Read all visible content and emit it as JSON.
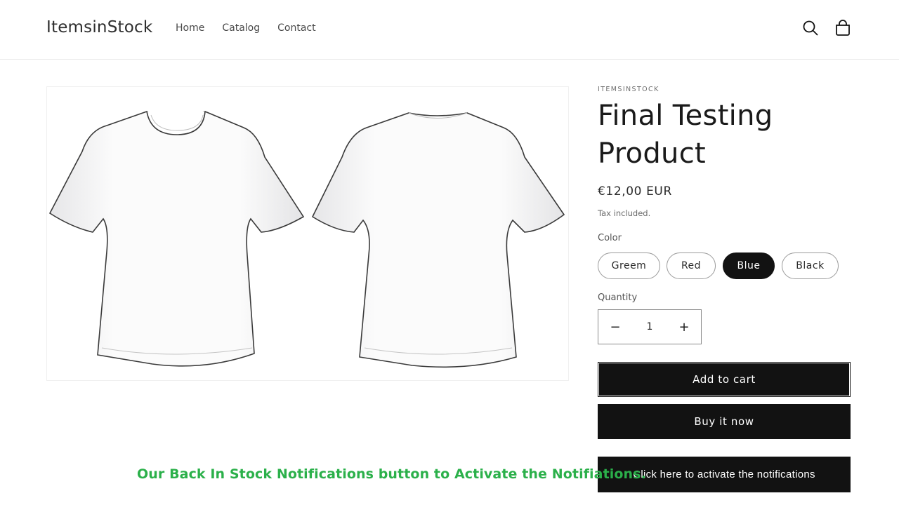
{
  "header": {
    "logo": "ItemsinStock",
    "nav": [
      "Home",
      "Catalog",
      "Contact"
    ],
    "icons": [
      "search-icon",
      "cart-icon"
    ]
  },
  "product": {
    "image_icon": "tshirt-front-back-image",
    "vendor": "ITEMSINSTOCK",
    "title": "Final Testing Product",
    "price": "€12,00 EUR",
    "tax_note": "Tax included.",
    "color_label": "Color",
    "colors": [
      {
        "label": "Greem",
        "selected": false
      },
      {
        "label": "Red",
        "selected": false
      },
      {
        "label": "Blue",
        "selected": true
      },
      {
        "label": "Black",
        "selected": false
      }
    ],
    "quantity_label": "Quantity",
    "quantity_value": "1",
    "decrease_symbol": "−",
    "increase_symbol": "+",
    "add_to_cart": "Add to cart",
    "buy_now": "Buy it now",
    "notify_button": "Click here to activate the notifications"
  },
  "caption": "Our Back In Stock Notifications button to Activate the Notifiations.",
  "colors": {
    "primary_button": "#121212",
    "caption_green": "#2bb04a",
    "border": "#e8e8e8"
  }
}
